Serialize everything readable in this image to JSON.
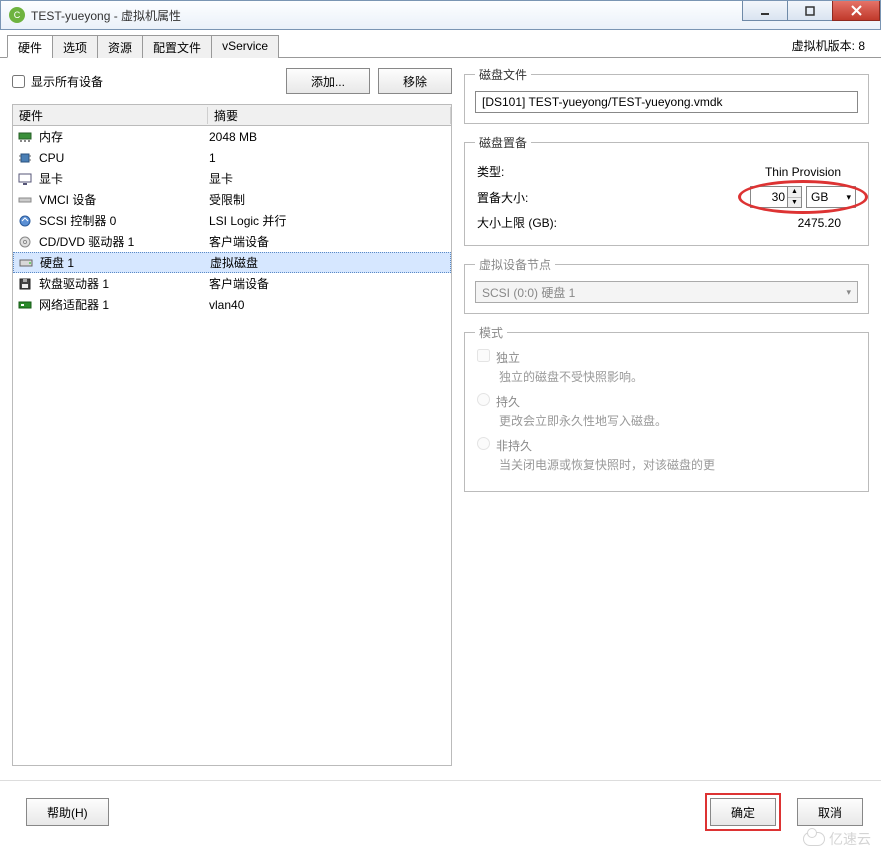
{
  "window": {
    "title": "TEST-yueyong - 虚拟机属性"
  },
  "tabs": [
    "硬件",
    "选项",
    "资源",
    "配置文件",
    "vService"
  ],
  "vm_version_label": "虚拟机版本: 8",
  "left": {
    "show_all_label": "显示所有设备",
    "add_btn": "添加...",
    "remove_btn": "移除",
    "col_hw": "硬件",
    "col_sum": "摘要",
    "rows": [
      {
        "icon": "mem",
        "name": "内存",
        "summary": "2048 MB"
      },
      {
        "icon": "cpu",
        "name": "CPU",
        "summary": "1"
      },
      {
        "icon": "video",
        "name": "显卡",
        "summary": "显卡"
      },
      {
        "icon": "vmci",
        "name": "VMCI 设备",
        "summary": "受限制"
      },
      {
        "icon": "scsi",
        "name": "SCSI 控制器 0",
        "summary": "LSI Logic 并行"
      },
      {
        "icon": "cd",
        "name": "CD/DVD 驱动器 1",
        "summary": "客户端设备"
      },
      {
        "icon": "disk",
        "name": "硬盘 1",
        "summary": "虚拟磁盘",
        "selected": true
      },
      {
        "icon": "floppy",
        "name": "软盘驱动器 1",
        "summary": "客户端设备"
      },
      {
        "icon": "nic",
        "name": "网络适配器 1",
        "summary": "vlan40"
      }
    ]
  },
  "right": {
    "disk_file": {
      "legend": "磁盘文件",
      "value": "[DS101] TEST-yueyong/TEST-yueyong.vmdk"
    },
    "provision": {
      "legend": "磁盘置备",
      "type_label": "类型:",
      "type_value": "Thin Provision",
      "size_label": "置备大小:",
      "size_value": "30",
      "size_unit": "GB",
      "max_label": "大小上限 (GB):",
      "max_value": "2475.20"
    },
    "node": {
      "legend": "虚拟设备节点",
      "value": "SCSI (0:0) 硬盘 1"
    },
    "mode": {
      "legend": "模式",
      "independent": "独立",
      "independent_desc": "独立的磁盘不受快照影响。",
      "persistent": "持久",
      "persistent_desc": "更改会立即永久性地写入磁盘。",
      "nonpersistent": "非持久",
      "nonpersistent_desc": "当关闭电源或恢复快照时，对该磁盘的更"
    }
  },
  "footer": {
    "help": "帮助(H)",
    "ok": "确定",
    "cancel": "取消"
  },
  "watermark": "亿速云"
}
